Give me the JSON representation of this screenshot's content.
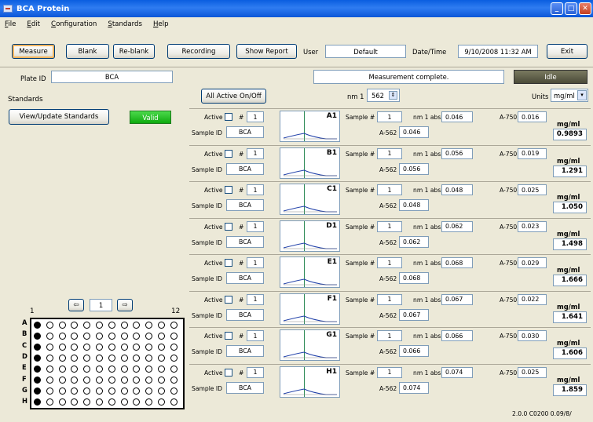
{
  "window": {
    "title": "BCA Protein"
  },
  "menu": [
    "File",
    "Edit",
    "Configuration",
    "Standards",
    "Help"
  ],
  "toolbar": {
    "measure": "Measure",
    "blank": "Blank",
    "reblank": "Re-blank",
    "recording": "Recording",
    "show_report": "Show Report",
    "user_label": "User",
    "user_value": "Default",
    "datetime_label": "Date/Time",
    "datetime_value": "9/10/2008 11:32 AM",
    "exit": "Exit"
  },
  "plate_id": {
    "label": "Plate ID",
    "value": "BCA"
  },
  "status": {
    "message": "Measurement complete.",
    "state": "Idle"
  },
  "standards": {
    "label": "Standards",
    "view_update": "View/Update Standards",
    "validity": "Valid"
  },
  "controls": {
    "all_active": "All Active On/Off",
    "nm_label": "nm 1",
    "nm_value": "562",
    "units_label": "Units",
    "units_value": "mg/ml"
  },
  "row_labels": {
    "active": "Active",
    "hash": "#",
    "sample_id": "Sample ID",
    "sample_num": "Sample #",
    "nm1abs": "nm 1 abs.",
    "a750": "A-750",
    "a562": "A-562",
    "unit": "mg/ml"
  },
  "samples": [
    {
      "active_num": "1",
      "sample_id": "BCA",
      "well": "A1",
      "sample_num": "1",
      "nm1abs": "0.046",
      "a750": "0.016",
      "a562": "0.046",
      "conc": "0.9893"
    },
    {
      "active_num": "1",
      "sample_id": "BCA",
      "well": "B1",
      "sample_num": "1",
      "nm1abs": "0.056",
      "a750": "0.019",
      "a562": "0.056",
      "conc": "1.291"
    },
    {
      "active_num": "1",
      "sample_id": "BCA",
      "well": "C1",
      "sample_num": "1",
      "nm1abs": "0.048",
      "a750": "0.025",
      "a562": "0.048",
      "conc": "1.050"
    },
    {
      "active_num": "1",
      "sample_id": "BCA",
      "well": "D1",
      "sample_num": "1",
      "nm1abs": "0.062",
      "a750": "0.023",
      "a562": "0.062",
      "conc": "1.498"
    },
    {
      "active_num": "1",
      "sample_id": "BCA",
      "well": "E1",
      "sample_num": "1",
      "nm1abs": "0.068",
      "a750": "0.029",
      "a562": "0.068",
      "conc": "1.666"
    },
    {
      "active_num": "1",
      "sample_id": "BCA",
      "well": "F1",
      "sample_num": "1",
      "nm1abs": "0.067",
      "a750": "0.022",
      "a562": "0.067",
      "conc": "1.641"
    },
    {
      "active_num": "1",
      "sample_id": "BCA",
      "well": "G1",
      "sample_num": "1",
      "nm1abs": "0.066",
      "a750": "0.030",
      "a562": "0.066",
      "conc": "1.606"
    },
    {
      "active_num": "1",
      "sample_id": "BCA",
      "well": "H1",
      "sample_num": "1",
      "nm1abs": "0.074",
      "a750": "0.025",
      "a562": "0.074",
      "conc": "1.859"
    }
  ],
  "plate_nav": {
    "col_start": "1",
    "col_end": "12",
    "current": "1",
    "rows": [
      "A",
      "B",
      "C",
      "D",
      "E",
      "F",
      "G",
      "H"
    ],
    "active_column": 1
  },
  "version": "2.0.0 C0200 0.09/8/"
}
